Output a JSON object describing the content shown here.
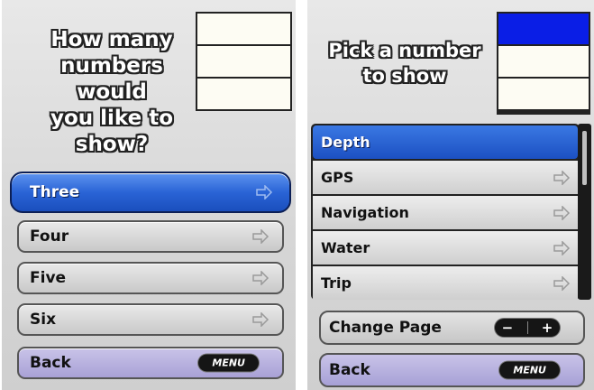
{
  "left": {
    "question": "How many\nnumbers would\nyou like to\nshow?",
    "options": [
      {
        "label": "Three",
        "selected": true
      },
      {
        "label": "Four",
        "selected": false
      },
      {
        "label": "Five",
        "selected": false
      },
      {
        "label": "Six",
        "selected": false
      }
    ],
    "back": {
      "label": "Back",
      "key": "MENU"
    }
  },
  "right": {
    "prompt": "Pick a number\nto show",
    "categories": [
      {
        "label": "Depth",
        "selected": true
      },
      {
        "label": "GPS",
        "selected": false
      },
      {
        "label": "Navigation",
        "selected": false
      },
      {
        "label": "Water",
        "selected": false
      },
      {
        "label": "Trip",
        "selected": false
      }
    ],
    "change_page": {
      "label": "Change Page",
      "minus": "−",
      "plus": "+"
    },
    "back": {
      "label": "Back",
      "key": "MENU"
    }
  },
  "colors": {
    "selected_blue": "#2a64d6",
    "active_field": "#0a1ee6",
    "back_button": "#b5aedc",
    "field_fill": "#fdfcf3"
  },
  "icons": {
    "option_arrow": "arrow-right-icon"
  }
}
